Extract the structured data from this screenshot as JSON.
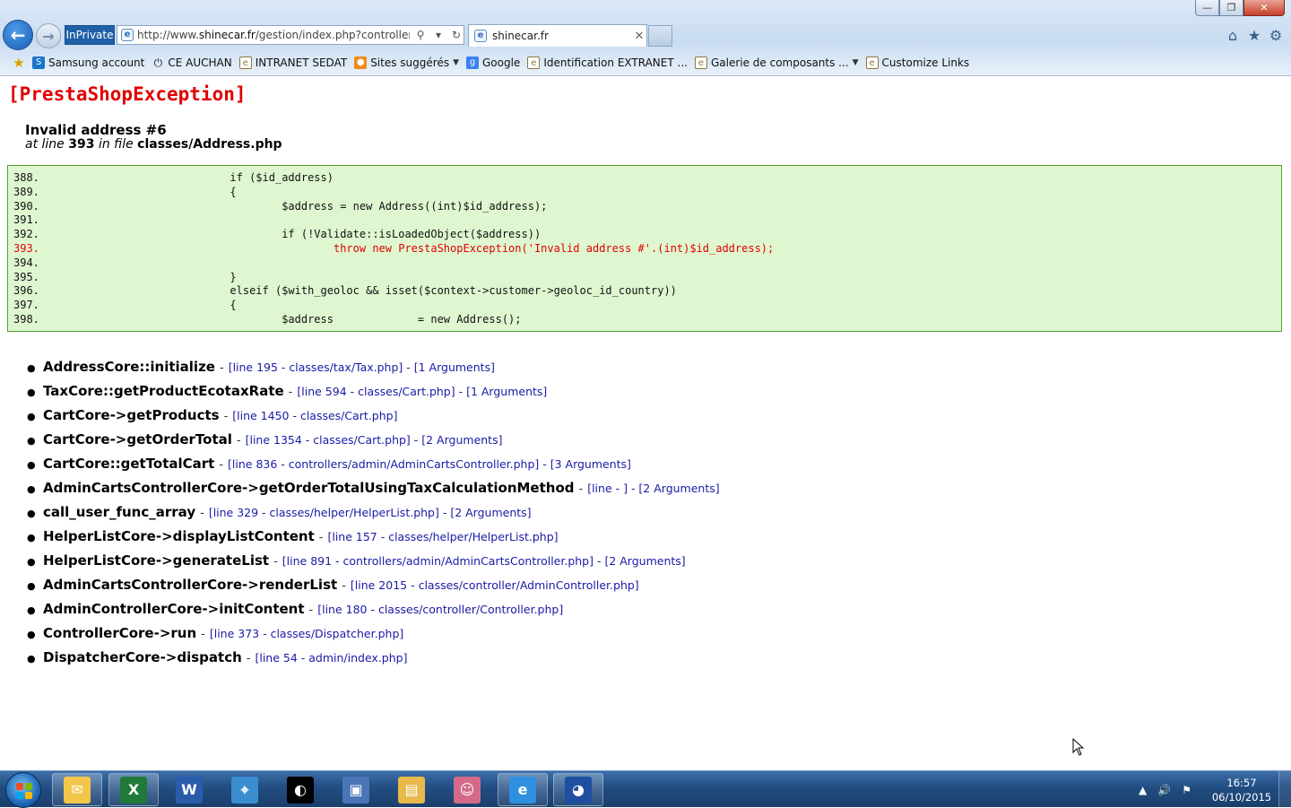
{
  "browser": {
    "inprivate_label": "InPrivate",
    "url_prefix": "http://www.",
    "url_domain": "shinecar.fr",
    "url_rest": "/gestion/index.php?controller=Adm",
    "tab_title": "shinecar.fr",
    "tab_close": "✕",
    "window_controls": {
      "minimize": "—",
      "maximize": "❐",
      "close": "✕"
    },
    "favorites": [
      {
        "label": "Samsung account",
        "icon": "samsung-icon"
      },
      {
        "label": "CE AUCHAN",
        "icon": "power-icon"
      },
      {
        "label": "INTRANET SEDAT",
        "icon": "page-icon"
      },
      {
        "label": "Sites suggérés",
        "icon": "orange-icon",
        "dropdown": true
      },
      {
        "label": "Google",
        "icon": "google-icon"
      },
      {
        "label": "Identification EXTRANET ...",
        "icon": "page-icon"
      },
      {
        "label": "Galerie de composants ...",
        "icon": "page-icon",
        "dropdown": true
      },
      {
        "label": "Customize Links",
        "icon": "page-icon"
      }
    ]
  },
  "exception": {
    "title": "[PrestaShopException]",
    "message": "Invalid address #6",
    "at_line_prefix": "at line",
    "line": "393",
    "in_file_prefix": "in file",
    "file": "classes/Address.php",
    "code_lines": [
      {
        "num": "388.",
        "code": "                        if ($id_address)",
        "error": false
      },
      {
        "num": "389.",
        "code": "                        {",
        "error": false
      },
      {
        "num": "390.",
        "code": "                                $address = new Address((int)$id_address);",
        "error": false
      },
      {
        "num": "391.",
        "code": "",
        "error": false
      },
      {
        "num": "392.",
        "code": "                                if (!Validate::isLoadedObject($address))",
        "error": false
      },
      {
        "num": "393.",
        "code": "                                        throw new PrestaShopException('Invalid address #'.(int)$id_address);",
        "error": true
      },
      {
        "num": "394.",
        "code": "",
        "error": false
      },
      {
        "num": "395.",
        "code": "                        }",
        "error": false
      },
      {
        "num": "396.",
        "code": "                        elseif ($with_geoloc && isset($context->customer->geoloc_id_country))",
        "error": false
      },
      {
        "num": "397.",
        "code": "                        {",
        "error": false
      },
      {
        "num": "398.",
        "code": "                                $address             = new Address();",
        "error": false
      }
    ],
    "stack_trace": [
      {
        "function": "AddressCore::initialize",
        "location": "[line 195 - classes/tax/Tax.php] - [1 Arguments]"
      },
      {
        "function": "TaxCore::getProductEcotaxRate",
        "location": "[line 594 - classes/Cart.php] - [1 Arguments]"
      },
      {
        "function": "CartCore->getProducts",
        "location": "[line 1450 - classes/Cart.php]"
      },
      {
        "function": "CartCore->getOrderTotal",
        "location": "[line 1354 - classes/Cart.php] - [2 Arguments]"
      },
      {
        "function": "CartCore::getTotalCart",
        "location": "[line 836 - controllers/admin/AdminCartsController.php] - [3 Arguments]"
      },
      {
        "function": "AdminCartsControllerCore->getOrderTotalUsingTaxCalculationMethod",
        "location": "[line - ] - [2 Arguments]"
      },
      {
        "function": "call_user_func_array",
        "location": "[line 329 - classes/helper/HelperList.php] - [2 Arguments]"
      },
      {
        "function": "HelperListCore->displayListContent",
        "location": "[line 157 - classes/helper/HelperList.php]"
      },
      {
        "function": "HelperListCore->generateList",
        "location": "[line 891 - controllers/admin/AdminCartsController.php] - [2 Arguments]"
      },
      {
        "function": "AdminCartsControllerCore->renderList",
        "location": "[line 2015 - classes/controller/AdminController.php]"
      },
      {
        "function": "AdminControllerCore->initContent",
        "location": "[line 180 - classes/controller/Controller.php]"
      },
      {
        "function": "ControllerCore->run",
        "location": "[line 373 - classes/Dispatcher.php]"
      },
      {
        "function": "DispatcherCore->dispatch",
        "location": "[line 54 - admin/index.php]"
      }
    ]
  },
  "taskbar": {
    "apps": [
      {
        "name": "outlook-app",
        "icon": "outlook-icon",
        "color": "#f3c64a",
        "glyph": "✉",
        "open": true
      },
      {
        "name": "excel-app",
        "icon": "excel-icon",
        "color": "#1f7a3a",
        "glyph": "X",
        "open": true
      },
      {
        "name": "word-app",
        "icon": "word-icon",
        "color": "#2a5cab",
        "glyph": "W",
        "open": false
      },
      {
        "name": "network-app",
        "icon": "network-icon",
        "color": "#3a8ed0",
        "glyph": "⌖",
        "open": false
      },
      {
        "name": "media-app",
        "icon": "media-icon",
        "color": "#000000",
        "glyph": "◐",
        "open": false
      },
      {
        "name": "remote-app",
        "icon": "remote-desktop-icon",
        "color": "#4a76b8",
        "glyph": "▣",
        "open": false
      },
      {
        "name": "explorer-app",
        "icon": "folder-icon",
        "color": "#e6b94a",
        "glyph": "▤",
        "open": false
      },
      {
        "name": "character-app",
        "icon": "character-icon",
        "color": "#d46a8a",
        "glyph": "☺",
        "open": false
      },
      {
        "name": "ie-app",
        "icon": "internet-explorer-icon",
        "color": "#2f8fe0",
        "glyph": "e",
        "open": true
      },
      {
        "name": "globe-app",
        "icon": "globe-icon",
        "color": "#1f4fa0",
        "glyph": "◕",
        "open": true
      }
    ],
    "time": "16:57",
    "date": "06/10/2015"
  }
}
